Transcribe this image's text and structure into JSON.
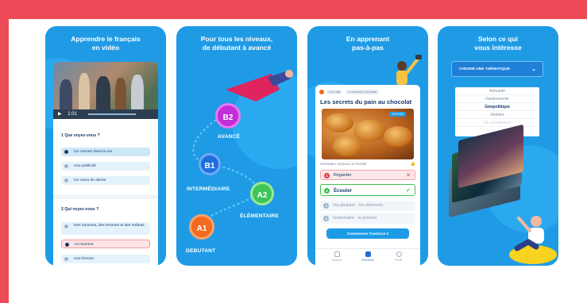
{
  "colors": {
    "accent_red": "#eb4a56",
    "panel_blue": "#1f9be6",
    "correct_green": "#3cbf4f",
    "wrong_red": "#e23d4d",
    "navy": "#163a6b"
  },
  "panel1": {
    "title_line1": "Apprendre le français",
    "title_line2": "en vidéo",
    "video_time": "1:01",
    "q1": "1  Que voyez-vous ?",
    "q1_options": [
      "Un concert dans la rue",
      "Une publicité",
      "Un cours de danse"
    ],
    "q2": "2  Qui voyez-vous ?",
    "q2_options": [
      "Des hommes, des femmes et des enfants.",
      "Un homme.",
      "Une femme."
    ]
  },
  "panel2": {
    "title_line1": "Pour tous les niveaux,",
    "title_line2": "de débutant à avancé",
    "levels": [
      {
        "code": "B2",
        "name": "AVANCÉ",
        "color": "#c12fd6"
      },
      {
        "code": "B1",
        "name": "INTERMÉDIAIRE",
        "color": "#1e6fde"
      },
      {
        "code": "A2",
        "name": "ÉLÉMENTAIRE",
        "color": "#3ec45a"
      },
      {
        "code": "A1",
        "name": "DÉBUTANT",
        "color": "#f26a1f"
      }
    ]
  },
  "panel3": {
    "title_line1": "En apprenant",
    "title_line2": "pas-à-pas",
    "chips": [
      "CULTURE",
      "1 LIGNE SUR LA FLAMME"
    ],
    "article_title": "Les secrets du pain au chocolat",
    "image_tag": "ÉDITION",
    "meta": "DISPONIBLE JUSQU'AU 15 FÉVRIER",
    "steps": [
      {
        "num": "1",
        "label": "Regarder",
        "state": "wrong",
        "mark": "✕"
      },
      {
        "num": "2",
        "label": "Écouter",
        "state": "correct",
        "mark": "✓"
      },
      {
        "num": "3",
        "label": "Vocabulaire · les éléments",
        "state": "todo"
      },
      {
        "num": "4",
        "label": "Grammaire · le présent",
        "state": "todo"
      }
    ],
    "cta": "Commencer l'exercice 2",
    "tabs": [
      "Accueil",
      "Exercices",
      "Profil"
    ]
  },
  "panel4": {
    "title_line1": "Selon ce qui",
    "title_line2": "vous intéresse",
    "theme_button": "CHOISIR UNE THÉMATIQUE",
    "themes": [
      "Actualité",
      "Gastronomie",
      "Géopolitique",
      "Histoire",
      "Vie quotidienne"
    ],
    "selected_theme": "Géopolitique"
  }
}
